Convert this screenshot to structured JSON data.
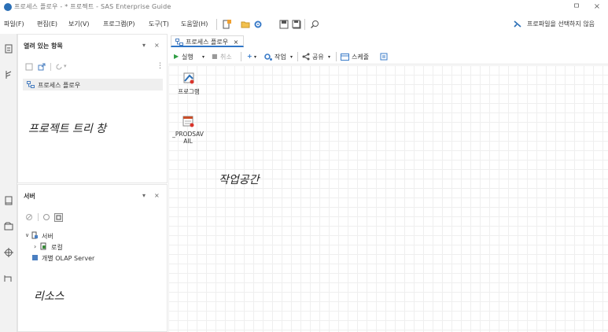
{
  "window": {
    "title": "프로세스 플로우 - * 프로젝트 - SAS Enterprise Guide",
    "minimize": "ㅁ",
    "close": "×"
  },
  "menu": {
    "items": [
      "파일(F)",
      "편집(E)",
      "보기(V)",
      "프로그램(P)",
      "도구(T)",
      "도움말(H)"
    ],
    "profile_text": "프로파일을 선택하지 않음"
  },
  "project_panel": {
    "title": "열려 있는 항목",
    "tree_item": "프로세스 플로우",
    "annotation": "프로젝트 트리 창"
  },
  "server_panel": {
    "title": "서버",
    "root": "서버",
    "child_local": "로컬",
    "child_olap": "개별 OLAP Server",
    "annotation": "리소스"
  },
  "workspace": {
    "tab_label": "프로세스 플로우",
    "toolbar": {
      "run": "실행",
      "stop": "취소",
      "task": "작업",
      "share": "공유",
      "schedule": "스케줄"
    },
    "nodes": [
      {
        "label": "프로그램"
      },
      {
        "label": "_PRODSAV\nAIL"
      }
    ],
    "annotation": "작업공간"
  },
  "colors": {
    "accent": "#2f76c7",
    "tab_underline": "#2f76c7"
  }
}
